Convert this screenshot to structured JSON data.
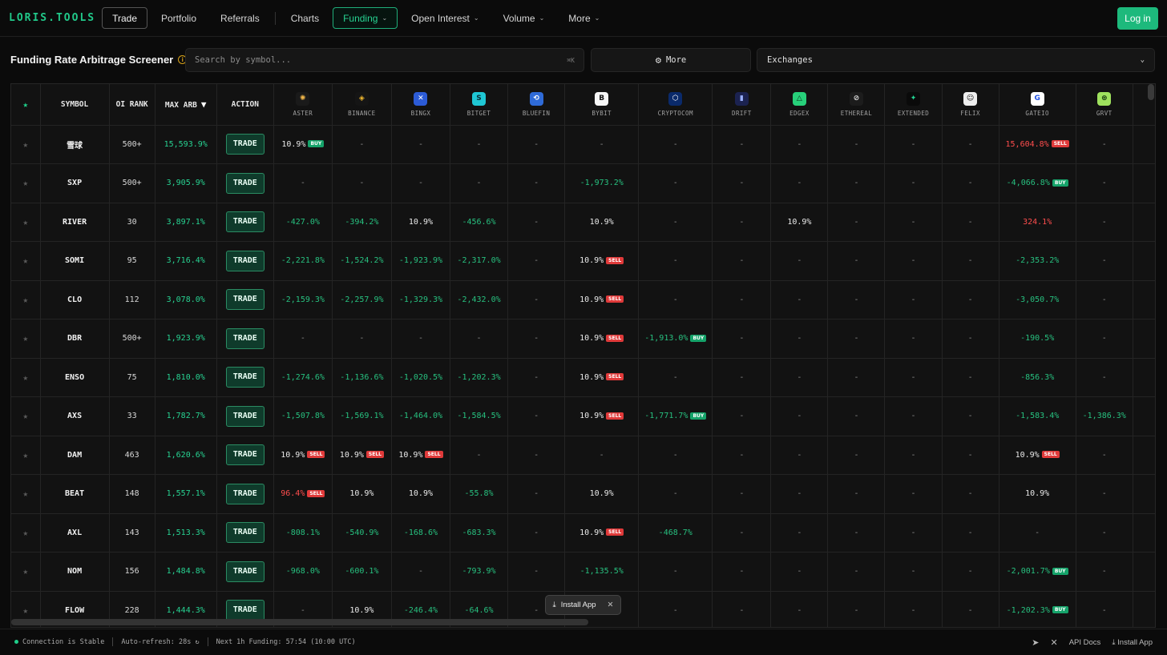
{
  "app": {
    "logo": "LORIS.TOOLS"
  },
  "nav": {
    "items": [
      {
        "label": "Trade",
        "style": "boxed"
      },
      {
        "label": "Portfolio"
      },
      {
        "label": "Referrals"
      },
      {
        "label": "Charts"
      },
      {
        "label": "Funding",
        "style": "active",
        "dropdown": true
      },
      {
        "label": "Open Interest",
        "dropdown": true
      },
      {
        "label": "Volume",
        "dropdown": true
      },
      {
        "label": "More",
        "dropdown": true
      }
    ],
    "login_label": "Log in"
  },
  "toolbar": {
    "title": "Funding Rate Arbitrage Screener",
    "search_placeholder": "Search by symbol...",
    "search_shortcut": "⌘K",
    "more_label": "More",
    "exchanges_label": "Exchanges"
  },
  "table": {
    "headers": {
      "symbol": "SYMBOL",
      "oi_rank": "OI RANK",
      "max_arb": "MAX ARB",
      "sort_indicator": "▼",
      "action": "ACTION",
      "trade_label": "TRADE"
    },
    "exchanges": [
      {
        "name": "ASTER",
        "icon": "aster-icon",
        "color": "#1a1a1a",
        "glyph": "✺",
        "glyph_color": "#f1b74a"
      },
      {
        "name": "BINANCE",
        "icon": "binance-icon",
        "color": "#151515",
        "glyph": "◈",
        "glyph_color": "#f3ba2f"
      },
      {
        "name": "BINGX",
        "icon": "bingx-icon",
        "color": "#2c5bd6",
        "glyph": "✕",
        "glyph_color": "#ffffff"
      },
      {
        "name": "BITGET",
        "icon": "bitget-icon",
        "color": "#1fc7d4",
        "glyph": "S",
        "glyph_color": "#0b2e38"
      },
      {
        "name": "BLUEFIN",
        "icon": "bluefin-icon",
        "color": "#2f6bd8",
        "glyph": "⟲",
        "glyph_color": "#ffffff"
      },
      {
        "name": "BYBIT",
        "icon": "bybit-icon",
        "color": "#f5f5f5",
        "glyph": "B",
        "glyph_color": "#111111"
      },
      {
        "name": "CRYPTOCOM",
        "icon": "cryptocom-icon",
        "color": "#0a2a6b",
        "glyph": "⬡",
        "glyph_color": "#ffffff"
      },
      {
        "name": "DRIFT",
        "icon": "drift-icon",
        "color": "#1b2250",
        "glyph": "▮",
        "glyph_color": "#9ab0ff"
      },
      {
        "name": "EDGEX",
        "icon": "edgex-icon",
        "color": "#27d07a",
        "glyph": "△",
        "glyph_color": "#0a2d18"
      },
      {
        "name": "ETHEREAL",
        "icon": "ethereal-icon",
        "color": "#1c1c1c",
        "glyph": "⊘",
        "glyph_color": "#dddddd"
      },
      {
        "name": "EXTENDED",
        "icon": "extended-icon",
        "color": "#0a0a0a",
        "glyph": "✦",
        "glyph_color": "#22d493"
      },
      {
        "name": "FELIX",
        "icon": "felix-icon",
        "color": "#eeeeee",
        "glyph": "☺",
        "glyph_color": "#111111"
      },
      {
        "name": "GATEIO",
        "icon": "gateio-icon",
        "color": "#ffffff",
        "glyph": "G",
        "glyph_color": "#2354e6"
      },
      {
        "name": "GRVT",
        "icon": "grvt-icon",
        "color": "#9fe25e",
        "glyph": "⊛",
        "glyph_color": "#10320a"
      }
    ],
    "rows": [
      {
        "symbol": "雪球",
        "oi_rank": "500+",
        "max_arb": "15,593.9%",
        "starred": false,
        "cells": [
          {
            "v": "10.9%",
            "c": "neu",
            "t": "BUY"
          },
          {
            "v": "-"
          },
          {
            "v": "-"
          },
          {
            "v": "-"
          },
          {
            "v": "-"
          },
          {
            "v": "-"
          },
          {
            "v": "-"
          },
          {
            "v": "-"
          },
          {
            "v": "-"
          },
          {
            "v": "-"
          },
          {
            "v": "-"
          },
          {
            "v": "-"
          },
          {
            "v": "15,604.8%",
            "c": "pos",
            "t": "SELL"
          },
          {
            "v": "-"
          }
        ]
      },
      {
        "symbol": "SXP",
        "oi_rank": "500+",
        "max_arb": "3,905.9%",
        "starred": false,
        "cells": [
          {
            "v": "-"
          },
          {
            "v": "-"
          },
          {
            "v": "-"
          },
          {
            "v": "-"
          },
          {
            "v": "-"
          },
          {
            "v": "-1,973.2%",
            "c": "neg"
          },
          {
            "v": "-"
          },
          {
            "v": "-"
          },
          {
            "v": "-"
          },
          {
            "v": "-"
          },
          {
            "v": "-"
          },
          {
            "v": "-"
          },
          {
            "v": "-4,066.8%",
            "c": "neg",
            "t": "BUY"
          },
          {
            "v": "-"
          }
        ]
      },
      {
        "symbol": "RIVER",
        "oi_rank": "30",
        "max_arb": "3,897.1%",
        "starred": false,
        "cells": [
          {
            "v": "-427.0%",
            "c": "neg"
          },
          {
            "v": "-394.2%",
            "c": "neg"
          },
          {
            "v": "10.9%",
            "c": "neu"
          },
          {
            "v": "-456.6%",
            "c": "neg"
          },
          {
            "v": "-"
          },
          {
            "v": "10.9%",
            "c": "neu"
          },
          {
            "v": "-"
          },
          {
            "v": "-"
          },
          {
            "v": "10.9%",
            "c": "neu"
          },
          {
            "v": "-"
          },
          {
            "v": "-"
          },
          {
            "v": "-"
          },
          {
            "v": "324.1%",
            "c": "pos"
          },
          {
            "v": "-"
          }
        ]
      },
      {
        "symbol": "SOMI",
        "oi_rank": "95",
        "max_arb": "3,716.4%",
        "starred": false,
        "cells": [
          {
            "v": "-2,221.8%",
            "c": "neg"
          },
          {
            "v": "-1,524.2%",
            "c": "neg"
          },
          {
            "v": "-1,923.9%",
            "c": "neg"
          },
          {
            "v": "-2,317.0%",
            "c": "neg"
          },
          {
            "v": "-"
          },
          {
            "v": "10.9%",
            "c": "neu",
            "t": "SELL"
          },
          {
            "v": "-"
          },
          {
            "v": "-"
          },
          {
            "v": "-"
          },
          {
            "v": "-"
          },
          {
            "v": "-"
          },
          {
            "v": "-"
          },
          {
            "v": "-2,353.2%",
            "c": "neg"
          },
          {
            "v": "-"
          }
        ]
      },
      {
        "symbol": "CLO",
        "oi_rank": "112",
        "max_arb": "3,078.0%",
        "starred": false,
        "cells": [
          {
            "v": "-2,159.3%",
            "c": "neg"
          },
          {
            "v": "-2,257.9%",
            "c": "neg"
          },
          {
            "v": "-1,329.3%",
            "c": "neg"
          },
          {
            "v": "-2,432.0%",
            "c": "neg"
          },
          {
            "v": "-"
          },
          {
            "v": "10.9%",
            "c": "neu",
            "t": "SELL"
          },
          {
            "v": "-"
          },
          {
            "v": "-"
          },
          {
            "v": "-"
          },
          {
            "v": "-"
          },
          {
            "v": "-"
          },
          {
            "v": "-"
          },
          {
            "v": "-3,050.7%",
            "c": "neg"
          },
          {
            "v": "-"
          }
        ]
      },
      {
        "symbol": "DBR",
        "oi_rank": "500+",
        "max_arb": "1,923.9%",
        "starred": false,
        "cells": [
          {
            "v": "-"
          },
          {
            "v": "-"
          },
          {
            "v": "-"
          },
          {
            "v": "-"
          },
          {
            "v": "-"
          },
          {
            "v": "10.9%",
            "c": "neu",
            "t": "SELL"
          },
          {
            "v": "-1,913.0%",
            "c": "neg",
            "t": "BUY"
          },
          {
            "v": "-"
          },
          {
            "v": "-"
          },
          {
            "v": "-"
          },
          {
            "v": "-"
          },
          {
            "v": "-"
          },
          {
            "v": "-190.5%",
            "c": "neg"
          },
          {
            "v": "-"
          }
        ]
      },
      {
        "symbol": "ENSO",
        "oi_rank": "75",
        "max_arb": "1,810.0%",
        "starred": false,
        "cells": [
          {
            "v": "-1,274.6%",
            "c": "neg"
          },
          {
            "v": "-1,136.6%",
            "c": "neg"
          },
          {
            "v": "-1,020.5%",
            "c": "neg"
          },
          {
            "v": "-1,202.3%",
            "c": "neg"
          },
          {
            "v": "-"
          },
          {
            "v": "10.9%",
            "c": "neu",
            "t": "SELL"
          },
          {
            "v": "-"
          },
          {
            "v": "-"
          },
          {
            "v": "-"
          },
          {
            "v": "-"
          },
          {
            "v": "-"
          },
          {
            "v": "-"
          },
          {
            "v": "-856.3%",
            "c": "neg"
          },
          {
            "v": "-"
          }
        ]
      },
      {
        "symbol": "AXS",
        "oi_rank": "33",
        "max_arb": "1,782.7%",
        "starred": false,
        "cells": [
          {
            "v": "-1,507.8%",
            "c": "neg"
          },
          {
            "v": "-1,569.1%",
            "c": "neg"
          },
          {
            "v": "-1,464.0%",
            "c": "neg"
          },
          {
            "v": "-1,584.5%",
            "c": "neg"
          },
          {
            "v": "-"
          },
          {
            "v": "10.9%",
            "c": "neu",
            "t": "SELL"
          },
          {
            "v": "-1,771.7%",
            "c": "neg",
            "t": "BUY"
          },
          {
            "v": "-"
          },
          {
            "v": "-"
          },
          {
            "v": "-"
          },
          {
            "v": "-"
          },
          {
            "v": "-"
          },
          {
            "v": "-1,583.4%",
            "c": "neg"
          },
          {
            "v": "-1,386.3%",
            "c": "neg"
          }
        ]
      },
      {
        "symbol": "DAM",
        "oi_rank": "463",
        "max_arb": "1,620.6%",
        "starred": false,
        "cells": [
          {
            "v": "10.9%",
            "c": "neu",
            "t": "SELL"
          },
          {
            "v": "10.9%",
            "c": "neu",
            "t": "SELL"
          },
          {
            "v": "10.9%",
            "c": "neu",
            "t": "SELL"
          },
          {
            "v": "-"
          },
          {
            "v": "-"
          },
          {
            "v": "-"
          },
          {
            "v": "-"
          },
          {
            "v": "-"
          },
          {
            "v": "-"
          },
          {
            "v": "-"
          },
          {
            "v": "-"
          },
          {
            "v": "-"
          },
          {
            "v": "10.9%",
            "c": "neu",
            "t": "SELL"
          },
          {
            "v": "-"
          }
        ]
      },
      {
        "symbol": "BEAT",
        "oi_rank": "148",
        "max_arb": "1,557.1%",
        "starred": false,
        "cells": [
          {
            "v": "96.4%",
            "c": "pos",
            "t": "SELL"
          },
          {
            "v": "10.9%",
            "c": "neu"
          },
          {
            "v": "10.9%",
            "c": "neu"
          },
          {
            "v": "-55.8%",
            "c": "neg"
          },
          {
            "v": "-"
          },
          {
            "v": "10.9%",
            "c": "neu"
          },
          {
            "v": "-"
          },
          {
            "v": "-"
          },
          {
            "v": "-"
          },
          {
            "v": "-"
          },
          {
            "v": "-"
          },
          {
            "v": "-"
          },
          {
            "v": "10.9%",
            "c": "neu"
          },
          {
            "v": "-"
          }
        ]
      },
      {
        "symbol": "AXL",
        "oi_rank": "143",
        "max_arb": "1,513.3%",
        "starred": false,
        "cells": [
          {
            "v": "-808.1%",
            "c": "neg"
          },
          {
            "v": "-540.9%",
            "c": "neg"
          },
          {
            "v": "-168.6%",
            "c": "neg"
          },
          {
            "v": "-683.3%",
            "c": "neg"
          },
          {
            "v": "-"
          },
          {
            "v": "10.9%",
            "c": "neu",
            "t": "SELL"
          },
          {
            "v": "-468.7%",
            "c": "neg"
          },
          {
            "v": "-"
          },
          {
            "v": "-"
          },
          {
            "v": "-"
          },
          {
            "v": "-"
          },
          {
            "v": "-"
          },
          {
            "v": "-"
          },
          {
            "v": "-"
          }
        ]
      },
      {
        "symbol": "NOM",
        "oi_rank": "156",
        "max_arb": "1,484.8%",
        "starred": false,
        "cells": [
          {
            "v": "-968.0%",
            "c": "neg"
          },
          {
            "v": "-600.1%",
            "c": "neg"
          },
          {
            "v": "-"
          },
          {
            "v": "-793.9%",
            "c": "neg"
          },
          {
            "v": "-"
          },
          {
            "v": "-1,135.5%",
            "c": "neg"
          },
          {
            "v": "-"
          },
          {
            "v": "-"
          },
          {
            "v": "-"
          },
          {
            "v": "-"
          },
          {
            "v": "-"
          },
          {
            "v": "-"
          },
          {
            "v": "-2,001.7%",
            "c": "neg",
            "t": "BUY"
          },
          {
            "v": "-"
          }
        ]
      },
      {
        "symbol": "FLOW",
        "oi_rank": "228",
        "max_arb": "1,444.3%",
        "starred": false,
        "cells": [
          {
            "v": "-"
          },
          {
            "v": "10.9%",
            "c": "neu"
          },
          {
            "v": "-246.4%",
            "c": "neg"
          },
          {
            "v": "-64.6%",
            "c": "neg"
          },
          {
            "v": "-"
          },
          {
            "v": "-"
          },
          {
            "v": "-"
          },
          {
            "v": "-"
          },
          {
            "v": "-"
          },
          {
            "v": "-"
          },
          {
            "v": "-"
          },
          {
            "v": "-"
          },
          {
            "v": "-1,202.3%",
            "c": "neg",
            "t": "BUY"
          },
          {
            "v": "-"
          }
        ]
      }
    ]
  },
  "install_popup": {
    "label": "Install App",
    "close": "✕"
  },
  "footer": {
    "status": "Connection is Stable",
    "refresh": "Auto-refresh: 28s ↻",
    "next_funding": "Next 1h Funding: 57:54 (10:00 UTC)",
    "api_docs": "API Docs",
    "install": "Install App"
  },
  "colors": {
    "accent": "#1db97c",
    "negative_rate": "#27c07f",
    "positive_rate": "#ff4d4d",
    "sell_tag": "#e03a3a",
    "buy_tag": "#15a36a"
  }
}
